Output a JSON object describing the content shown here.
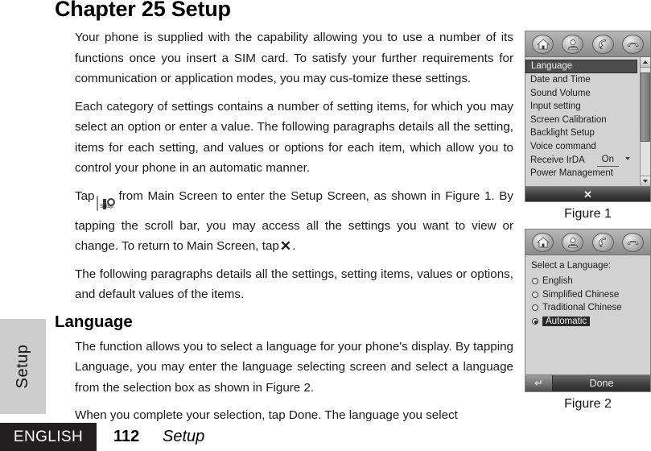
{
  "chapter": {
    "title": "Chapter 25 Setup"
  },
  "body": {
    "p1": "Your phone is supplied with the capability allowing you to use a number of its functions once you insert a SIM card. To satisfy your further requirements for communication or application modes, you may cus-tomize these settings.",
    "p2": "Each category of settings contains a number of setting items, for which you may select an option or enter a value. The following paragraphs details all the setting, items for each setting, and values or options for each item, which allow you to control your phone in an automatic manner.",
    "p3_before_icon": "Tap",
    "p3_icon_caption": "Setup",
    "p3_after_icon": "from Main Screen to enter the Setup Screen, as shown in Figure 1. By tapping the scroll bar, you may access all the settings you want to view or change. To return to Main Screen, tap",
    "p3_x_glyph": "✕",
    "p3_end": ".",
    "p4": "The following paragraphs details all the settings, setting items, values or options, and default values of the items.",
    "section_heading": "Language",
    "p5": "The function allows you to select a language for your phone's display. By tapping Language, you may enter the language selecting screen and select a language from the selection box as shown in Figure 2.",
    "p6": "When you complete your selection, tap Done. The language you select"
  },
  "side_tab": {
    "label": "Setup"
  },
  "footer": {
    "language": "ENGLISH",
    "page_number": "112",
    "section": "Setup"
  },
  "figure1": {
    "caption": "Figure 1",
    "toolbar_icons": [
      "home-icon",
      "contacts-icon",
      "call-icon",
      "end-call-icon"
    ],
    "items": [
      {
        "label": "Language",
        "value": "",
        "selected": true,
        "has_caret": false
      },
      {
        "label": "Date and Time",
        "value": "",
        "selected": false,
        "has_caret": false
      },
      {
        "label": "Sound Volume",
        "value": "",
        "selected": false,
        "has_caret": false
      },
      {
        "label": "Input setting",
        "value": "",
        "selected": false,
        "has_caret": false
      },
      {
        "label": "Screen Calibration",
        "value": "",
        "selected": false,
        "has_caret": false
      },
      {
        "label": "Backlight Setup",
        "value": "",
        "selected": false,
        "has_caret": false
      },
      {
        "label": "Voice command",
        "value": "",
        "selected": false,
        "has_caret": false
      },
      {
        "label": "Receive IrDA",
        "value": "On",
        "selected": false,
        "has_caret": true
      },
      {
        "label": "Power Management",
        "value": "",
        "selected": false,
        "has_caret": false
      }
    ],
    "close_glyph": "✕"
  },
  "figure2": {
    "caption": "Figure 2",
    "toolbar_icons": [
      "home-icon",
      "contacts-icon",
      "call-icon",
      "end-call-icon"
    ],
    "prompt": "Select a Language:",
    "options": [
      {
        "label": "English",
        "checked": false
      },
      {
        "label": "Simplified Chinese",
        "checked": false
      },
      {
        "label": "Traditional Chinese",
        "checked": false
      },
      {
        "label": "Automatic",
        "checked": true
      }
    ],
    "back_glyph": "↵",
    "done_label": "Done"
  },
  "colors": {
    "footer_bar": "#231f20",
    "side_tab": "#cdcdcd",
    "device_bg": "#d2d2d2",
    "selection": "#4d4d4d"
  }
}
